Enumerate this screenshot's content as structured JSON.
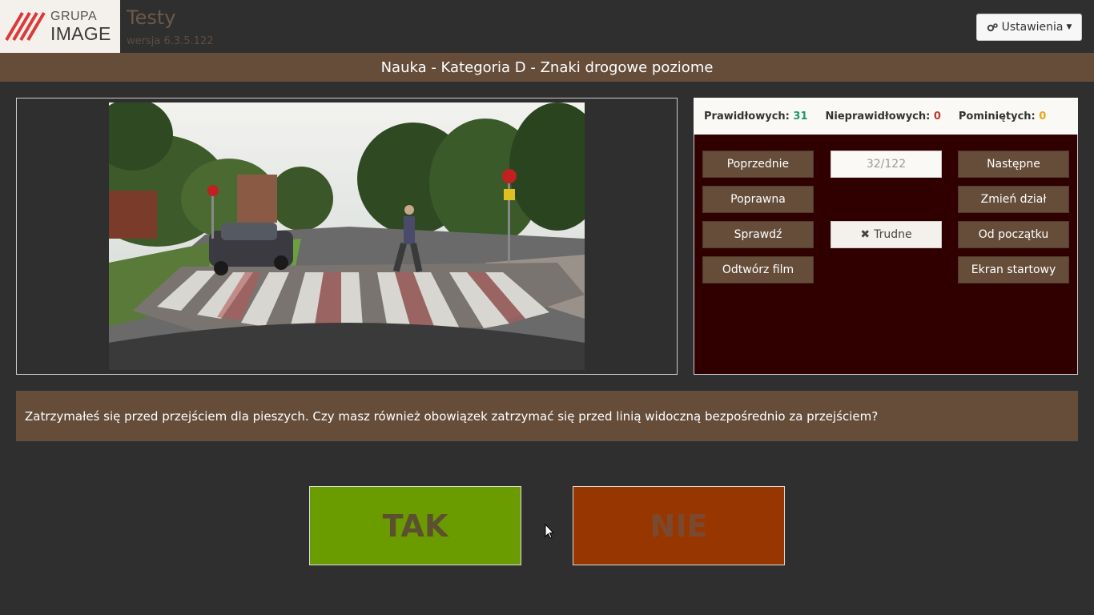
{
  "header": {
    "logo_top": "GRUPA",
    "logo_bottom": "IMAGE",
    "app_title": "Testy",
    "version": "wersja 6.3.5.122",
    "settings_label": "Ustawienia",
    "settings_icon": "gears-icon"
  },
  "subheader": {
    "title": "Nauka - Kategoria D - Znaki drogowe poziome"
  },
  "stats": {
    "correct_label": "Prawidłowych:",
    "correct_value": "31",
    "incorrect_label": "Nieprawidłowych:",
    "incorrect_value": "0",
    "skipped_label": "Pominiętych:",
    "skipped_value": "0"
  },
  "controls": {
    "previous": "Poprzednie",
    "counter": "32/122",
    "next": "Następne",
    "correct_answer": "Poprawna",
    "change_section": "Zmień dział",
    "check": "Sprawdź",
    "hard": "Trudne",
    "hard_icon": "times-icon",
    "from_start": "Od początku",
    "play_film": "Odtwórz film",
    "start_screen": "Ekran startowy"
  },
  "question": {
    "text": "Zatrzymałeś się przed przejściem dla pieszych. Czy masz również obowiązek zatrzymać się przed linią widoczną bezpośrednio za przejściem?"
  },
  "answers": {
    "yes": "TAK",
    "no": "NIE"
  },
  "colors": {
    "brown": "#654d3a",
    "dark_red": "#300000",
    "yes_green": "#6a9c00",
    "no_orange": "#983600"
  }
}
